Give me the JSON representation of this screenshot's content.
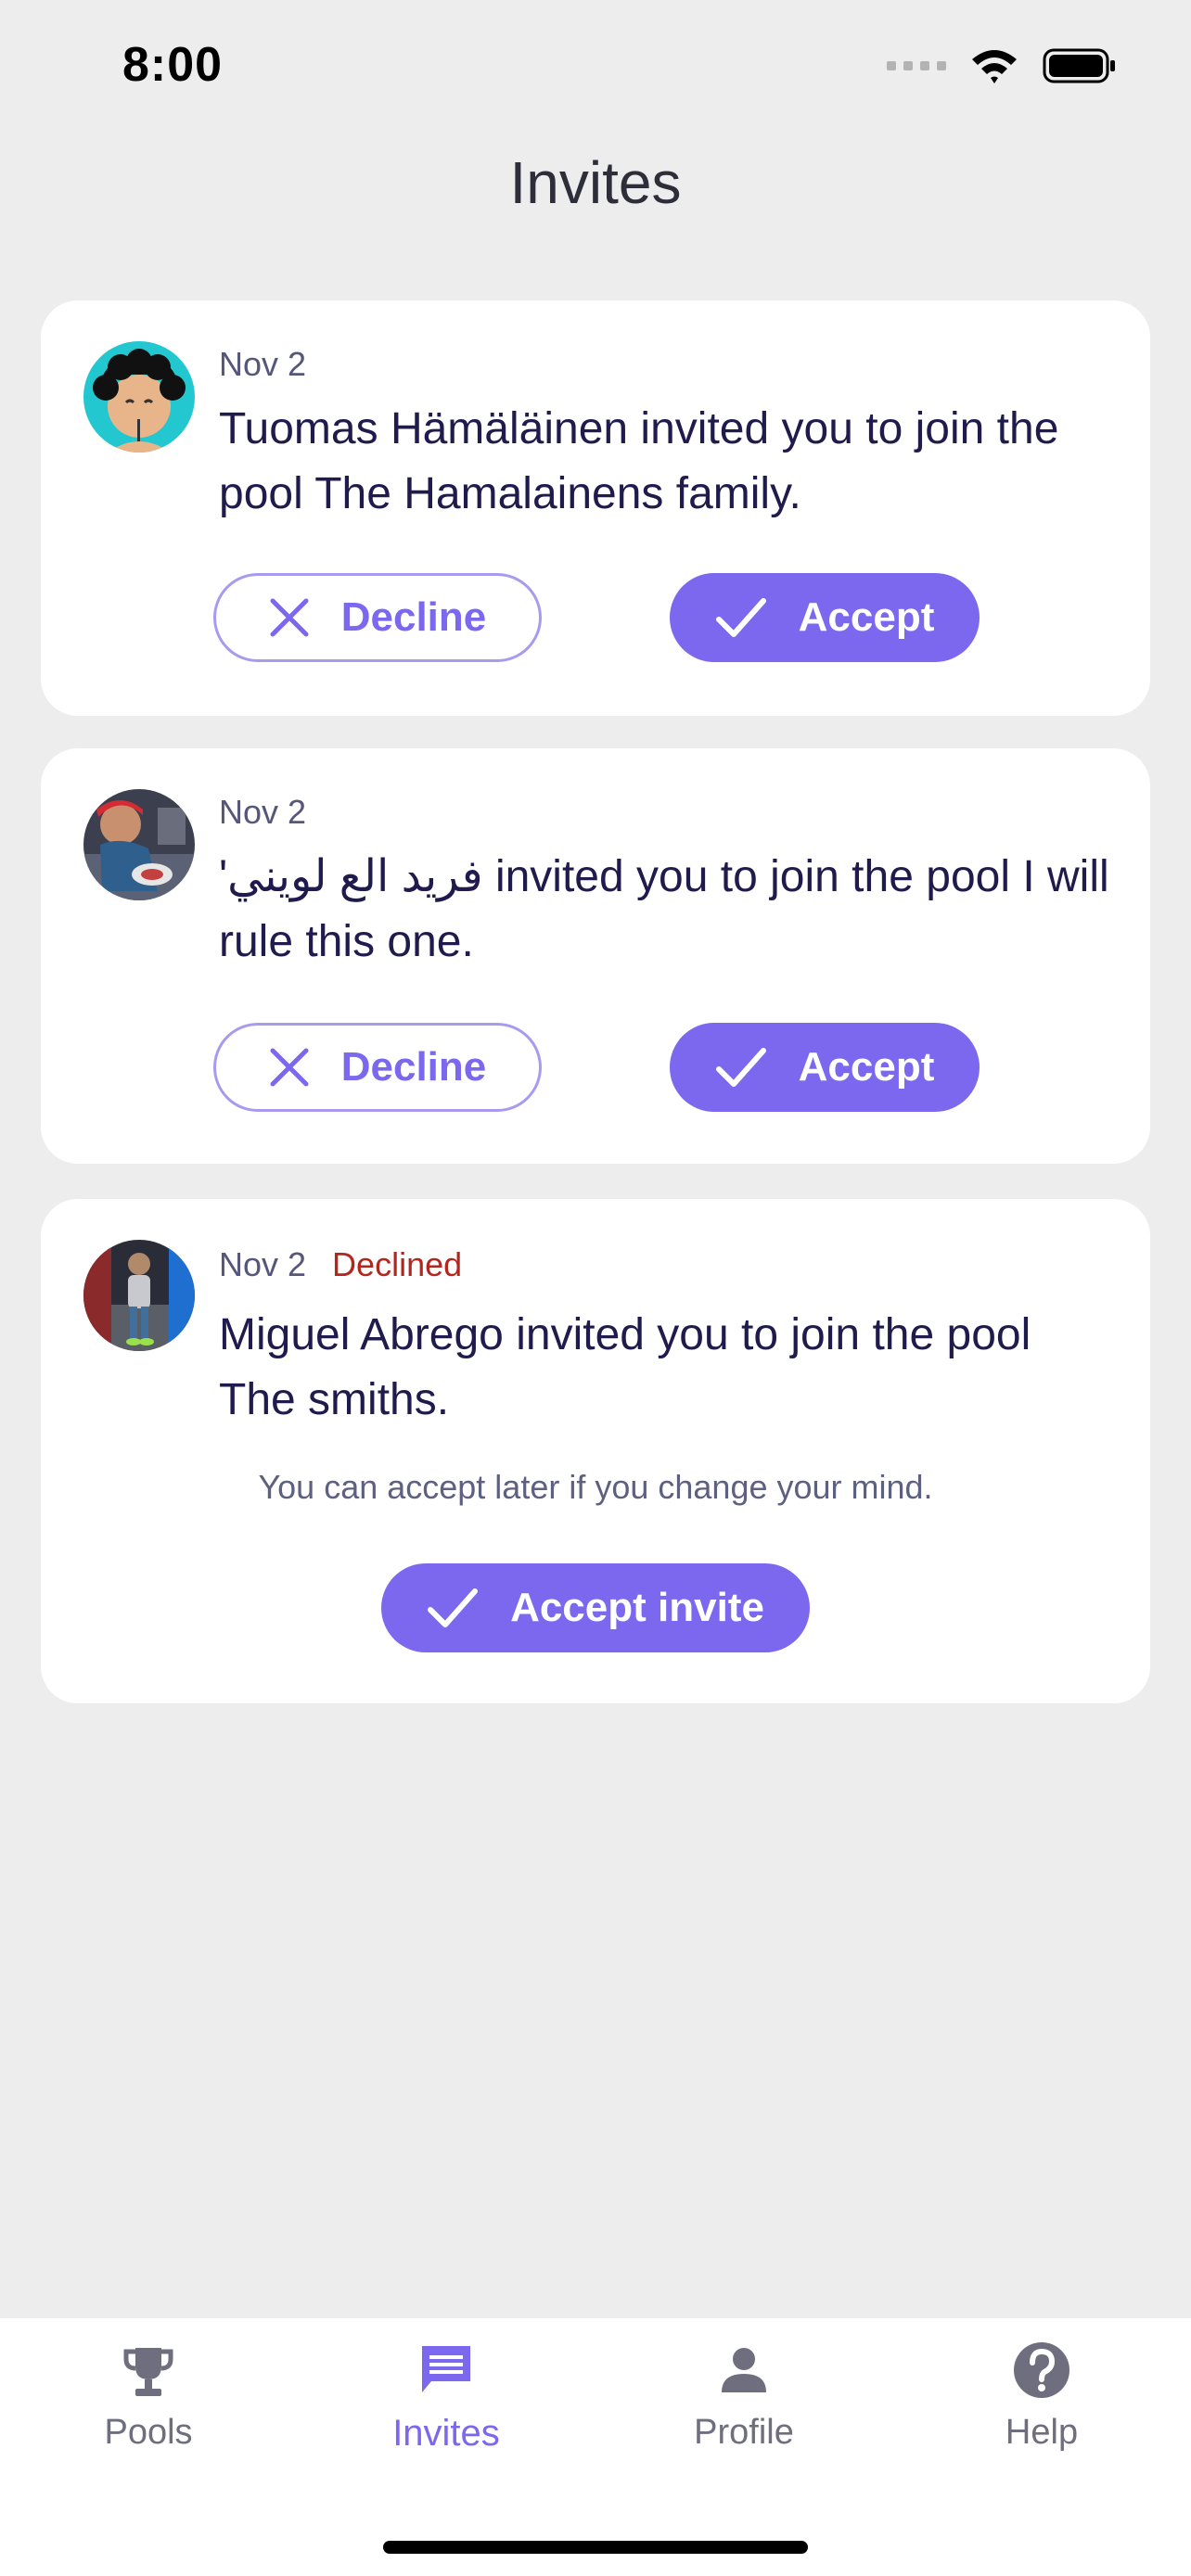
{
  "status": {
    "time": "8:00"
  },
  "page": {
    "title": "Invites"
  },
  "invites": [
    {
      "date": "Nov 2",
      "status": "",
      "message": "Tuomas Hämäläinen invited you to join the pool The Hamalainens family.",
      "decline_label": "Decline",
      "accept_label": "Accept"
    },
    {
      "date": "Nov 2",
      "status": "",
      "message": "'فريد الع لويني invited you to join the pool I will rule this one.",
      "decline_label": "Decline",
      "accept_label": "Accept"
    },
    {
      "date": "Nov 2",
      "status": "Declined",
      "message": "Miguel Abrego invited you to join the pool The smiths.",
      "note": "You can accept later if you change your mind.",
      "accept_invite_label": "Accept invite"
    }
  ],
  "nav": {
    "items": [
      {
        "label": "Pools",
        "icon": "trophy-icon"
      },
      {
        "label": "Invites",
        "icon": "chat-icon",
        "active": true
      },
      {
        "label": "Profile",
        "icon": "person-icon"
      },
      {
        "label": "Help",
        "icon": "help-icon"
      }
    ]
  },
  "colors": {
    "accent": "#7B68EE",
    "declined": "#B3261E",
    "background": "#EDEDED"
  }
}
